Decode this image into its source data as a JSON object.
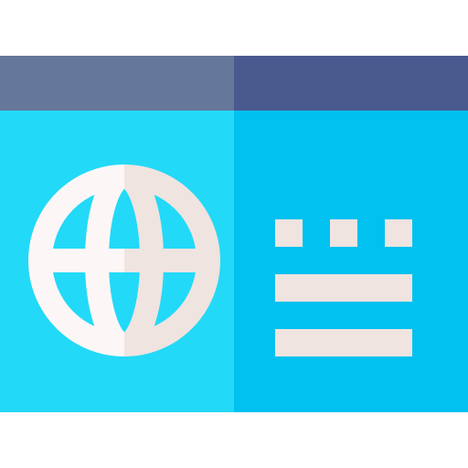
{
  "icon": {
    "name": "web-browser-window-icon",
    "elements": {
      "title_bar": "window-title-bar",
      "content_area": "window-content-area",
      "globe": "globe-icon",
      "text_block": "text-lines-icon"
    },
    "colors": {
      "title_bar_left": "#65789b",
      "title_bar_right": "#4a5a8f",
      "content_left": "#23d9f8",
      "content_right": "#00c1ef",
      "glyph_left": "#fcf7f6",
      "glyph_right": "#efe4e0"
    }
  }
}
